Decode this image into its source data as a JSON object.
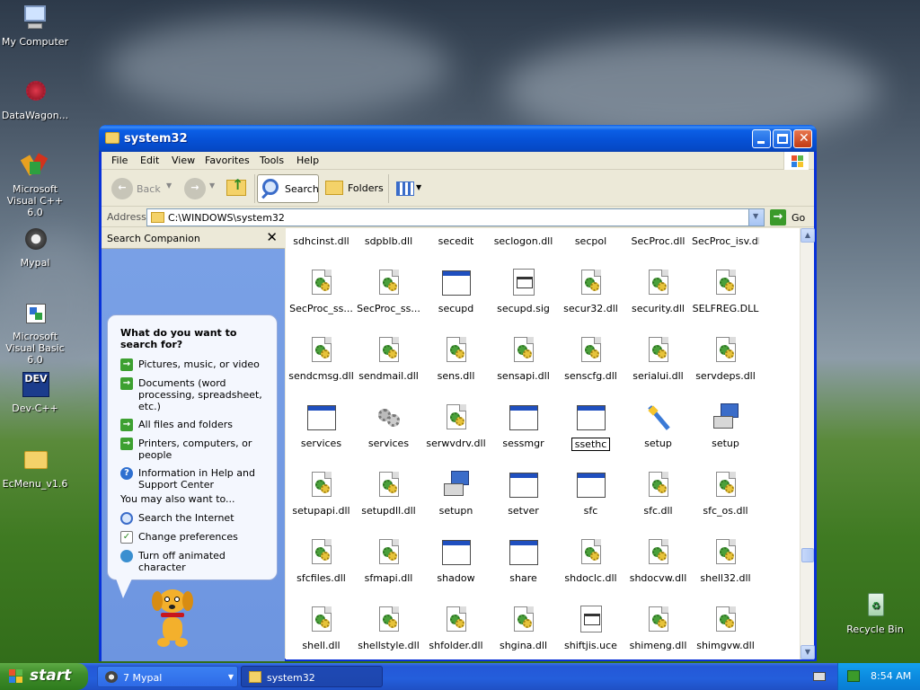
{
  "desktop": {
    "icons": [
      {
        "label": "My Computer"
      },
      {
        "label": "DataWagon..."
      },
      {
        "label": "Microsoft Visual C++ 6.0"
      },
      {
        "label": "Mypal"
      },
      {
        "label": "Microsoft Visual Basic 6.0"
      },
      {
        "label": "Dev-C++"
      },
      {
        "label": "EcMenu_v1.6"
      },
      {
        "label": "Recycle Bin"
      }
    ],
    "devcpp_badge": "DEV"
  },
  "window": {
    "title": "system32",
    "menu": [
      "File",
      "Edit",
      "View",
      "Favorites",
      "Tools",
      "Help"
    ],
    "toolbar": {
      "back": "Back",
      "search": "Search",
      "folders": "Folders"
    },
    "address": {
      "label": "Address",
      "value": "C:\\WINDOWS\\system32",
      "go": "Go"
    },
    "search_companion": {
      "title": "Search Companion",
      "close": "✕",
      "question": "What do you want to search for?",
      "options": [
        "Pictures, music, or video",
        "Documents (word processing, spreadsheet, etc.)",
        "All files and folders",
        "Printers, computers, or people",
        "Information in Help and Support Center"
      ],
      "also_title": "You may also want to...",
      "also": [
        "Search the Internet",
        "Change preferences",
        "Turn off animated character"
      ]
    },
    "files": [
      {
        "name": "sdhcinst.dll",
        "type": "dll"
      },
      {
        "name": "sdpblb.dll",
        "type": "dll"
      },
      {
        "name": "secedit",
        "type": "exe"
      },
      {
        "name": "seclogon.dll",
        "type": "dll"
      },
      {
        "name": "secpol",
        "type": "exe"
      },
      {
        "name": "SecProc.dll",
        "type": "dll"
      },
      {
        "name": "SecProc_isv.dll",
        "type": "dll"
      },
      {
        "name": "SecProc_ss...",
        "type": "dll"
      },
      {
        "name": "SecProc_ss...",
        "type": "dll"
      },
      {
        "name": "secupd",
        "type": "exe"
      },
      {
        "name": "secupd.sig",
        "type": "doc"
      },
      {
        "name": "secur32.dll",
        "type": "dll"
      },
      {
        "name": "security.dll",
        "type": "dll"
      },
      {
        "name": "SELFREG.DLL",
        "type": "dll"
      },
      {
        "name": "sendcmsg.dll",
        "type": "dll"
      },
      {
        "name": "sendmail.dll",
        "type": "dll"
      },
      {
        "name": "sens.dll",
        "type": "dll"
      },
      {
        "name": "sensapi.dll",
        "type": "dll"
      },
      {
        "name": "senscfg.dll",
        "type": "dll"
      },
      {
        "name": "serialui.dll",
        "type": "dll"
      },
      {
        "name": "servdeps.dll",
        "type": "dll"
      },
      {
        "name": "services",
        "type": "exe"
      },
      {
        "name": "services",
        "type": "gears"
      },
      {
        "name": "serwvdrv.dll",
        "type": "dll"
      },
      {
        "name": "sessmgr",
        "type": "exe"
      },
      {
        "name": "ssethc",
        "type": "exe",
        "selected": true
      },
      {
        "name": "setup",
        "type": "wand"
      },
      {
        "name": "setup",
        "type": "installer"
      },
      {
        "name": "setupapi.dll",
        "type": "dll"
      },
      {
        "name": "setupdll.dll",
        "type": "dll"
      },
      {
        "name": "setupn",
        "type": "installer"
      },
      {
        "name": "setver",
        "type": "exe"
      },
      {
        "name": "sfc",
        "type": "exe"
      },
      {
        "name": "sfc.dll",
        "type": "dll"
      },
      {
        "name": "sfc_os.dll",
        "type": "dll"
      },
      {
        "name": "sfcfiles.dll",
        "type": "dll"
      },
      {
        "name": "sfmapi.dll",
        "type": "dll"
      },
      {
        "name": "shadow",
        "type": "exe"
      },
      {
        "name": "share",
        "type": "exe"
      },
      {
        "name": "shdoclc.dll",
        "type": "dll"
      },
      {
        "name": "shdocvw.dll",
        "type": "dll"
      },
      {
        "name": "shell32.dll",
        "type": "dll"
      },
      {
        "name": "shell.dll",
        "type": "dll"
      },
      {
        "name": "shellstyle.dll",
        "type": "dll"
      },
      {
        "name": "shfolder.dll",
        "type": "dll"
      },
      {
        "name": "shgina.dll",
        "type": "dll"
      },
      {
        "name": "shiftjis.uce",
        "type": "doc"
      },
      {
        "name": "shimeng.dll",
        "type": "dll"
      },
      {
        "name": "shimgvw.dll",
        "type": "dll"
      }
    ]
  },
  "taskbar": {
    "start": "start",
    "tasks": [
      {
        "label": "7 Mypal"
      },
      {
        "label": "system32"
      }
    ],
    "clock": "8:54 AM"
  },
  "colors": {
    "title_bar": "#0650d4",
    "pane_blue": "#7aa1e6",
    "taskbar": "#245edb",
    "start_green": "#3f8d2a"
  }
}
